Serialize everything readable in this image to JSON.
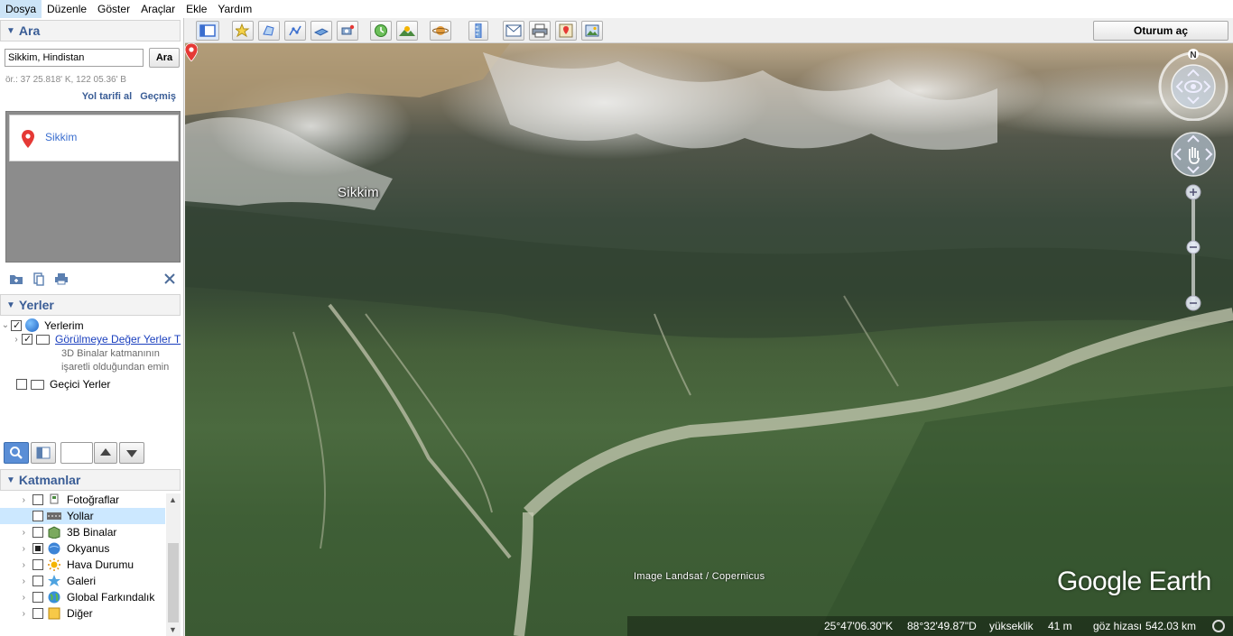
{
  "menu": {
    "items": [
      {
        "label": "Dosya",
        "active": true
      },
      {
        "label": "Düzenle",
        "active": false
      },
      {
        "label": "Göster",
        "active": false
      },
      {
        "label": "Araçlar",
        "active": false
      },
      {
        "label": "Ekle",
        "active": false
      },
      {
        "label": "Yardım",
        "active": false
      }
    ]
  },
  "search": {
    "header": "Ara",
    "input_value": "Sikkim, Hindistan",
    "button_label": "Ara",
    "hint": "ör.: 37 25.818' K, 122 05.36' B",
    "directions_label": "Yol tarifi al",
    "history_label": "Geçmiş",
    "result_label": "Sikkim"
  },
  "places": {
    "header": "Yerler",
    "my_places": "Yerlerim",
    "sightseeing": "Görülmeye Değer Yerler T",
    "note_line1": "3D Binalar katmanının",
    "note_line2": "işaretli olduğundan emin",
    "temporary": "Geçici Yerler"
  },
  "layers": {
    "header": "Katmanlar",
    "items": [
      {
        "label": "Fotoğraflar",
        "checked": false,
        "selected": false,
        "icon": "photo-icon"
      },
      {
        "label": "Yollar",
        "checked": false,
        "selected": true,
        "icon": "roads-icon"
      },
      {
        "label": "3B Binalar",
        "checked": false,
        "selected": false,
        "icon": "buildings-3d-icon"
      },
      {
        "label": "Okyanus",
        "checked": "partial",
        "selected": false,
        "icon": "ocean-icon"
      },
      {
        "label": "Hava Durumu",
        "checked": false,
        "selected": false,
        "icon": "weather-icon"
      },
      {
        "label": "Galeri",
        "checked": false,
        "selected": false,
        "icon": "gallery-icon"
      },
      {
        "label": "Global Farkındalık",
        "checked": false,
        "selected": false,
        "icon": "global-awareness-icon"
      },
      {
        "label": "Diğer",
        "checked": false,
        "selected": false,
        "icon": "more-icon"
      }
    ]
  },
  "toolbar": {
    "signin_label": "Oturum aç"
  },
  "map": {
    "pin_label": "Sikkim",
    "imagery_credit": "Image Landsat / Copernicus",
    "logo": "Google Earth",
    "compass_north": "N"
  },
  "status": {
    "lat": "25°47'06.30\"K",
    "lon": "88°32'49.87\"D",
    "elevation_label": "yükseklik",
    "elevation_value": "41 m",
    "eye_alt_label": "göz hizası",
    "eye_alt_value": "542.03 km"
  },
  "colors": {
    "section_header_text": "#3a5d96",
    "link": "#1a3fbe",
    "selected_row": "#cce8ff"
  }
}
